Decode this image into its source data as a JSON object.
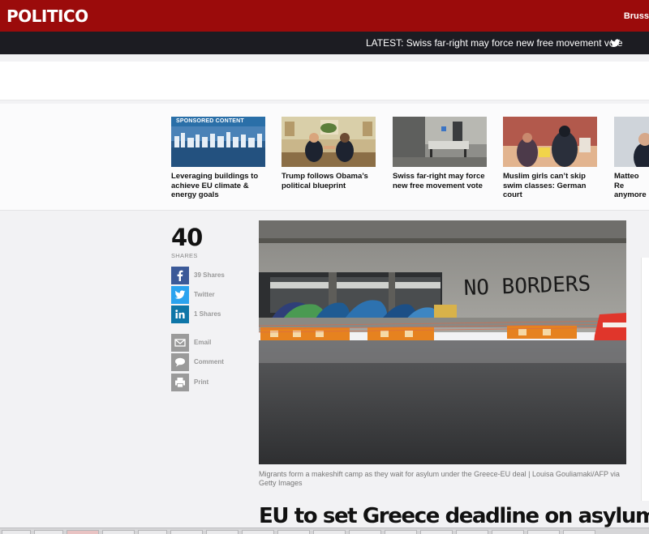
{
  "header": {
    "logo": "POLITICO",
    "edition": "Bruss"
  },
  "latest": {
    "text": "LATEST: Swiss far-right may force new free movement vote",
    "icon": "twitter-icon"
  },
  "recirc": {
    "cards": [
      {
        "tag": "SPONSORED CONTENT",
        "title": "Leveraging buildings to achieve EU climate & energy goals"
      },
      {
        "tag": "",
        "title": "Trump follows Obama’s political blueprint"
      },
      {
        "tag": "",
        "title": "Swiss far-right may force new free movement vote"
      },
      {
        "tag": "",
        "title": "Muslim girls can’t skip swim classes: German court"
      },
      {
        "tag": "",
        "title": "Matteo Re anymore"
      }
    ]
  },
  "share": {
    "count": "40",
    "label": "SHARES",
    "items": [
      {
        "name": "facebook",
        "label": "39 Shares",
        "color": "#3b5998"
      },
      {
        "name": "twitter",
        "label": "Twitter",
        "color": "#2aa3ef"
      },
      {
        "name": "linkedin",
        "label": "1 Shares",
        "color": "#0e76a8"
      },
      {
        "name": "email",
        "label": "Email",
        "color": "#9a9a9a"
      },
      {
        "name": "comment",
        "label": "Comment",
        "color": "#9a9a9a"
      },
      {
        "name": "print",
        "label": "Print",
        "color": "#9a9a9a"
      }
    ]
  },
  "article": {
    "caption": "Migrants form a makeshift camp as they wait for asylum under the Greece-EU deal | Louisa Gouliamaki/AFP via Getty Images",
    "headline": "EU to set Greece deadline on asylum seekers",
    "graffiti": "NO BORDERS"
  }
}
